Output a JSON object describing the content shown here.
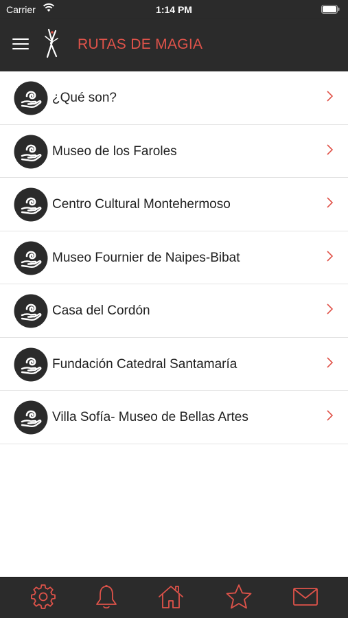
{
  "status_bar": {
    "carrier": "Carrier",
    "time": "1:14 PM"
  },
  "nav": {
    "title": "RUTAS DE MAGIA"
  },
  "list": {
    "items": [
      {
        "label": "¿Qué son?"
      },
      {
        "label": "Museo de los Faroles"
      },
      {
        "label": "Centro Cultural Montehermoso"
      },
      {
        "label": "Museo Fournier de Naipes-Bibat"
      },
      {
        "label": "Casa del Cordón"
      },
      {
        "label": "Fundación Catedral Santamaría"
      },
      {
        "label": "Villa Sofía- Museo de Bellas Artes"
      }
    ],
    "item_icon": "hand-magic-icon",
    "chevron_icon": "chevron-right-icon"
  },
  "tab_bar": {
    "tabs": [
      {
        "icon": "gear-icon"
      },
      {
        "icon": "bell-icon"
      },
      {
        "icon": "home-icon"
      },
      {
        "icon": "star-icon"
      },
      {
        "icon": "mail-icon"
      }
    ]
  },
  "colors": {
    "bar_background": "#2b2b2b",
    "accent": "#e0534a",
    "text": "#1f1f1f",
    "icon_circle": "#2b2b2b"
  }
}
